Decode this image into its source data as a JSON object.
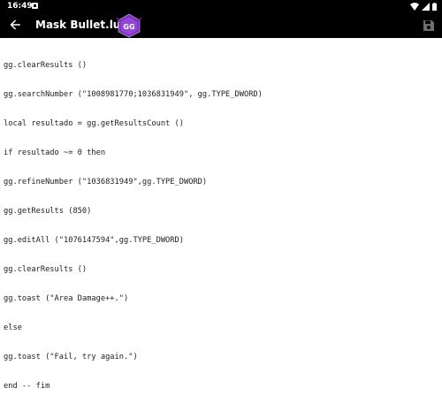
{
  "status_bar": {
    "time": "16:49",
    "icons": [
      "wifi-icon",
      "signal-icon",
      "battery-icon"
    ]
  },
  "app_bar": {
    "title": "Mask Bullet.lua",
    "logo_text": "GG",
    "colors": {
      "background": "#000000",
      "logo": "#7b2fbf",
      "save_icon": "#6e6e6e"
    }
  },
  "editor": {
    "lines": [
      "gg.clearResults ()",
      "gg.searchNumber (\"1008981770;1036831949\", gg.TYPE_DWORD)",
      "local resultado = gg.getResultsCount ()",
      "if resultado ~= 0 then",
      "gg.refineNumber (\"1036831949\",gg.TYPE_DWORD)",
      "gg.getResults (850)",
      "gg.editAll (\"1076147594\",gg.TYPE_DWORD)",
      "gg.clearResults ()",
      "gg.toast (\"Area Damage++.\")",
      "else",
      "gg.toast (\"Fail, try again.\")",
      "end -- fim"
    ]
  }
}
